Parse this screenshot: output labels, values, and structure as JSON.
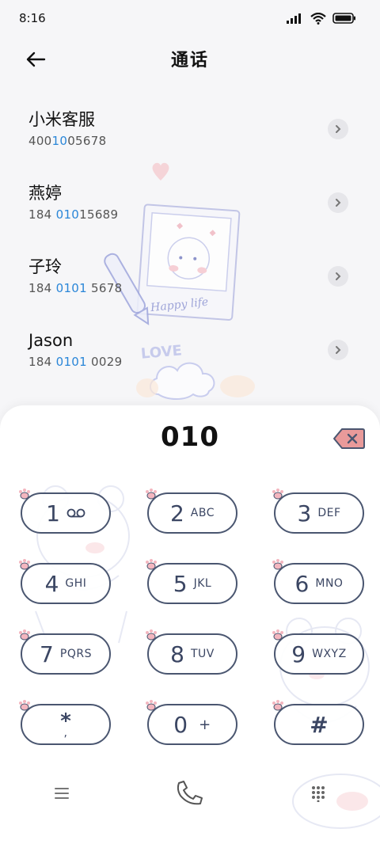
{
  "status_bar": {
    "time": "8:16"
  },
  "header": {
    "title": "通话"
  },
  "contacts": [
    {
      "name": "小米客服",
      "number_pre": "400",
      "number_hl": "10",
      "number_post": "05678"
    },
    {
      "name": "燕婷",
      "number_pre": "184 ",
      "number_hl": "010",
      "number_post": "15689"
    },
    {
      "name": "子玲",
      "number_pre": "184 ",
      "number_hl": "0101",
      "number_post": " 5678"
    },
    {
      "name": "Jason",
      "number_pre": "184 ",
      "number_hl": "0101",
      "number_post": " 0029"
    }
  ],
  "decoration": {
    "photo_caption": "Happy life",
    "love_text": "LOVE"
  },
  "dialpad": {
    "dialed": "010",
    "keys": [
      {
        "digit": "1",
        "letters": ""
      },
      {
        "digit": "2",
        "letters": "ABC"
      },
      {
        "digit": "3",
        "letters": "DEF"
      },
      {
        "digit": "4",
        "letters": "GHI"
      },
      {
        "digit": "5",
        "letters": "JKL"
      },
      {
        "digit": "6",
        "letters": "MNO"
      },
      {
        "digit": "7",
        "letters": "PQRS"
      },
      {
        "digit": "8",
        "letters": "TUV"
      },
      {
        "digit": "9",
        "letters": "WXYZ"
      },
      {
        "digit": "*",
        "letters": ","
      },
      {
        "digit": "0",
        "letters": "+"
      },
      {
        "digit": "#",
        "letters": ""
      }
    ]
  },
  "colors": {
    "key_border": "#4a5670",
    "highlight": "#2a86d8",
    "delete_bg": "#e99a9a"
  }
}
